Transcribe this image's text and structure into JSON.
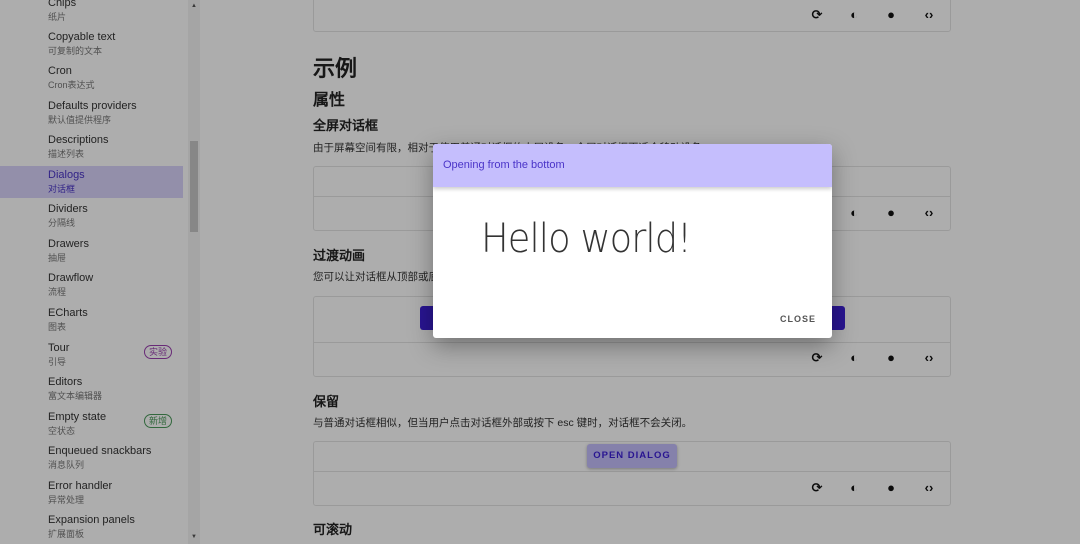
{
  "sidebar": {
    "items": [
      {
        "label": "Chips",
        "sub": "纸片"
      },
      {
        "label": "Copyable text",
        "sub": "可复制的文本"
      },
      {
        "label": "Cron",
        "sub": "Cron表达式"
      },
      {
        "label": "Defaults providers",
        "sub": "默认值提供程序"
      },
      {
        "label": "Descriptions",
        "sub": "描述列表"
      },
      {
        "label": "Dialogs",
        "sub": "对话框",
        "active": true
      },
      {
        "label": "Dividers",
        "sub": "分隔线"
      },
      {
        "label": "Drawers",
        "sub": "抽屉"
      },
      {
        "label": "Drawflow",
        "sub": "流程"
      },
      {
        "label": "ECharts",
        "sub": "图表"
      },
      {
        "label": "Tour",
        "sub": "引导",
        "badge": "实验"
      },
      {
        "label": "Editors",
        "sub": "富文本编辑器"
      },
      {
        "label": "Empty state",
        "sub": "空状态",
        "badge": "新增"
      },
      {
        "label": "Enqueued snackbars",
        "sub": "消息队列"
      },
      {
        "label": "Error handler",
        "sub": "异常处理"
      },
      {
        "label": "Expansion panels",
        "sub": "扩展面板"
      }
    ]
  },
  "main": {
    "examples_title": "示例",
    "props_title": "属性",
    "fullscreen": {
      "title": "全屏对话框",
      "desc": "由于屏幕空间有限，相对于使用普通对话框的大屏设备，全屏对话框更适合移动设备。"
    },
    "transition": {
      "title": "过渡动画",
      "desc": "您可以让对话框从顶部或底部弹出。"
    },
    "persistent": {
      "title": "保留",
      "desc": "与普通对话框相似，但当用户点击对话框外部或按下 esc 键时，对话框不会关闭。",
      "button": "OPEN DIALOG"
    },
    "scrollable": {
      "title": "可滚动"
    },
    "toolbar_icons": [
      "refresh-icon",
      "theme-contrast-icon",
      "github-icon",
      "code-icon"
    ]
  },
  "dialog": {
    "title": "Opening from the bottom",
    "body": "Hello world!",
    "close": "CLOSE"
  },
  "colors": {
    "accent": "#3d1fd6",
    "dialog_header": "#c5befd"
  }
}
